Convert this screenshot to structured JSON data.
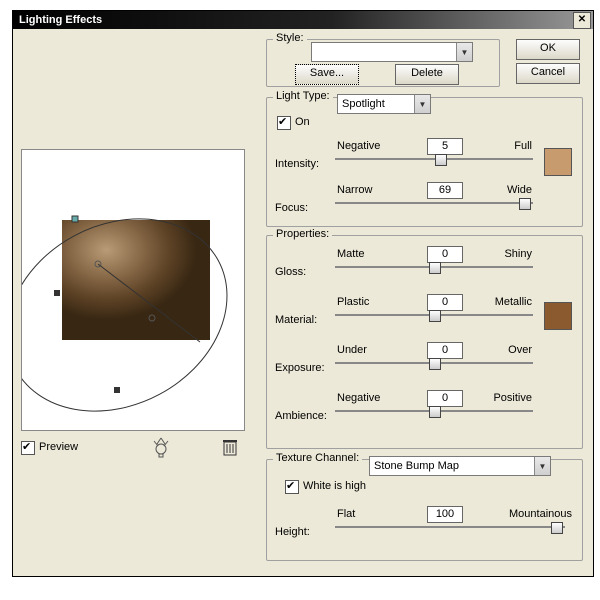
{
  "title": "Lighting Effects",
  "buttons": {
    "ok": "OK",
    "cancel": "Cancel",
    "save": "Save...",
    "delete": "Delete"
  },
  "style": {
    "label": "Style:",
    "value": ""
  },
  "preview": {
    "label": "Preview",
    "checked": true
  },
  "light": {
    "group": "Light Type:",
    "type": "Spotlight",
    "on_label": "On",
    "on": true,
    "intensity": {
      "name": "Intensity:",
      "min": "Negative",
      "max": "Full",
      "value": "5",
      "pos": 0.53
    },
    "focus": {
      "name": "Focus:",
      "min": "Narrow",
      "max": "Wide",
      "value": "69",
      "pos": 0.91
    },
    "swatch": "#c79b6d"
  },
  "props": {
    "group": "Properties:",
    "gloss": {
      "name": "Gloss:",
      "min": "Matte",
      "max": "Shiny",
      "value": "0",
      "pos": 0.5
    },
    "material": {
      "name": "Material:",
      "min": "Plastic",
      "max": "Metallic",
      "value": "0",
      "pos": 0.5
    },
    "exposure": {
      "name": "Exposure:",
      "min": "Under",
      "max": "Over",
      "value": "0",
      "pos": 0.5
    },
    "ambience": {
      "name": "Ambience:",
      "min": "Negative",
      "max": "Positive",
      "value": "0",
      "pos": 0.5
    },
    "swatch": "#8c5a2f"
  },
  "tex": {
    "label": "Texture Channel:",
    "value": "Stone Bump Map",
    "white": "White is high",
    "white_on": true,
    "height": {
      "name": "Height:",
      "min": "Flat",
      "max": "Mountainous",
      "value": "100",
      "pos": 0.95
    }
  }
}
